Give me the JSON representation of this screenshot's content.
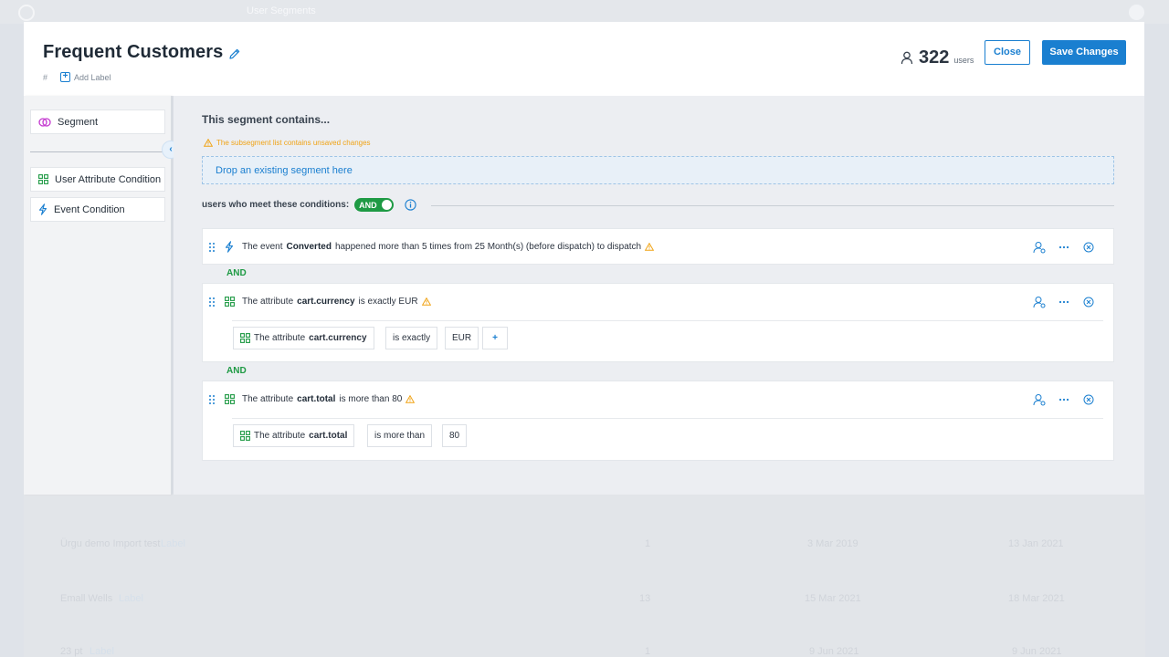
{
  "background": {
    "crumb": "User Segments",
    "rows": [
      {
        "name": "Ürgu demo Import test",
        "tag": "Label",
        "count": "1",
        "created": "3 Mar 2019",
        "updated": "13 Jan 2021"
      },
      {
        "name": "Emall Wells",
        "tag": "Label",
        "count": "13",
        "created": "15 Mar 2021",
        "updated": "18 Mar 2021"
      },
      {
        "name": "23 pt",
        "tag": "Label",
        "count": "1",
        "created": "9 Jun 2021",
        "updated": "9 Jun 2021"
      }
    ]
  },
  "header": {
    "title": "Frequent Customers",
    "hash": "#",
    "add_label": "Add Label",
    "user_count": "322",
    "user_unit": "users",
    "close_label": "Close",
    "save_label": "Save Changes"
  },
  "sidebar": {
    "segment": "Segment",
    "user_attribute": "User Attribute Condition",
    "event_condition": "Event Condition",
    "collapse": "‹"
  },
  "main": {
    "contains_title": "This segment contains...",
    "warning": "The subsegment list contains unsaved changes",
    "dropzone": "Drop an existing segment here",
    "conditions_label": "users who meet these conditions:",
    "toggle": "AND",
    "info": "i",
    "and_separator": "AND",
    "conditions": [
      {
        "prefix": "The event",
        "key": "Converted",
        "suffix": "happened more than 5 times from 25 Month(s) (before dispatch) to dispatch"
      },
      {
        "prefix": "The attribute",
        "key": "cart.currency",
        "suffix": "is exactly EUR",
        "chips": {
          "attr_prefix": "The attribute",
          "attr_key": "cart.currency",
          "operator": "is exactly",
          "value": "EUR",
          "add": "+"
        }
      },
      {
        "prefix": "The attribute",
        "key": "cart.total",
        "suffix": "is more than 80",
        "chips": {
          "attr_prefix": "The attribute",
          "attr_key": "cart.total",
          "operator": "is more than",
          "value": "80"
        }
      }
    ]
  },
  "colors": {
    "accent": "#1a7fd0",
    "green": "#1e9a44",
    "warning": "#f0a315"
  }
}
